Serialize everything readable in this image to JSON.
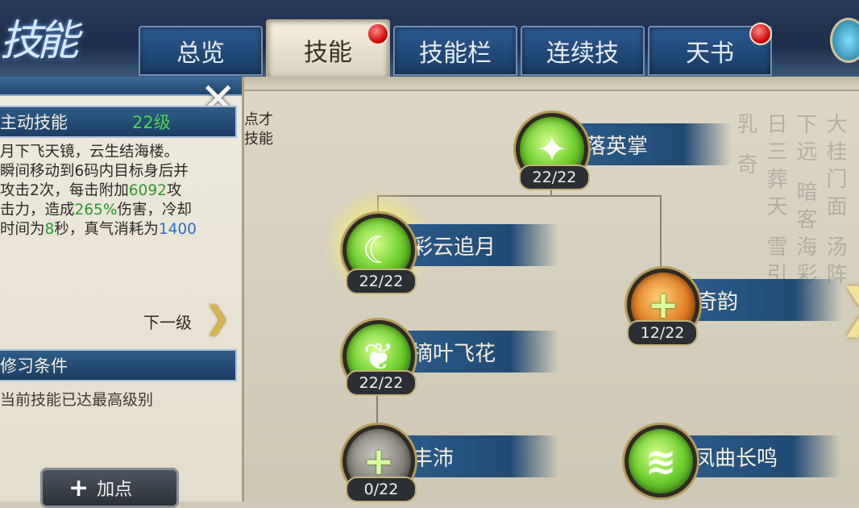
{
  "window": {
    "title_art": "技能"
  },
  "tabs": [
    {
      "label": "总览",
      "active": false,
      "badge": false
    },
    {
      "label": "技能",
      "active": true,
      "badge": true
    },
    {
      "label": "技能栏",
      "active": false,
      "badge": false
    },
    {
      "label": "连续技",
      "active": false,
      "badge": false
    },
    {
      "label": "天书",
      "active": false,
      "badge": true
    }
  ],
  "left_panel": {
    "section1_title": "主动技能",
    "level": "22级",
    "desc_line1": "月下飞天镜，云生结海楼。",
    "desc_line2": "瞬间移动到6码内目标身后并",
    "desc_line3_a": "攻击2次，每击附加",
    "desc_line3_num": "6092",
    "desc_line3_b": "攻",
    "desc_line4_a": "击力，造成",
    "desc_line4_num": "265%",
    "desc_line4_b": "伤害，冷却",
    "desc_line5_a": "时间为",
    "desc_line5_num": "8",
    "desc_line5_b": "秒，真气消耗为",
    "desc_line5_num2": "1400",
    "next_level": "下一级",
    "section2_title": "修习条件",
    "condition": "当前技能已达最高级别",
    "add_point": "加点"
  },
  "fragments": {
    "line1": "点才",
    "line2": "技能"
  },
  "skills": [
    {
      "name": "落英掌",
      "count": "22/22",
      "icon": "claw-skill-icon",
      "color": "green"
    },
    {
      "name": "彩云追月",
      "count": "22/22",
      "icon": "cloud-moon-skill-icon",
      "color": "green",
      "selected": true
    },
    {
      "name": "奇韵",
      "count": "12/22",
      "icon": "plus-orange-skill-icon",
      "color": "orange"
    },
    {
      "name": "摘叶飞花",
      "count": "22/22",
      "icon": "leaf-skill-icon",
      "color": "green"
    },
    {
      "name": "丰沛",
      "count": "0/22",
      "icon": "plus-grey-skill-icon",
      "color": "grey"
    },
    {
      "name": "凤曲长鸣",
      "count": "",
      "icon": "wind-skill-icon",
      "color": "green"
    }
  ],
  "background_calligraphy": "大桂门面 汤阵下远 暗客海彩 日三葬天 雪引乳 奇"
}
